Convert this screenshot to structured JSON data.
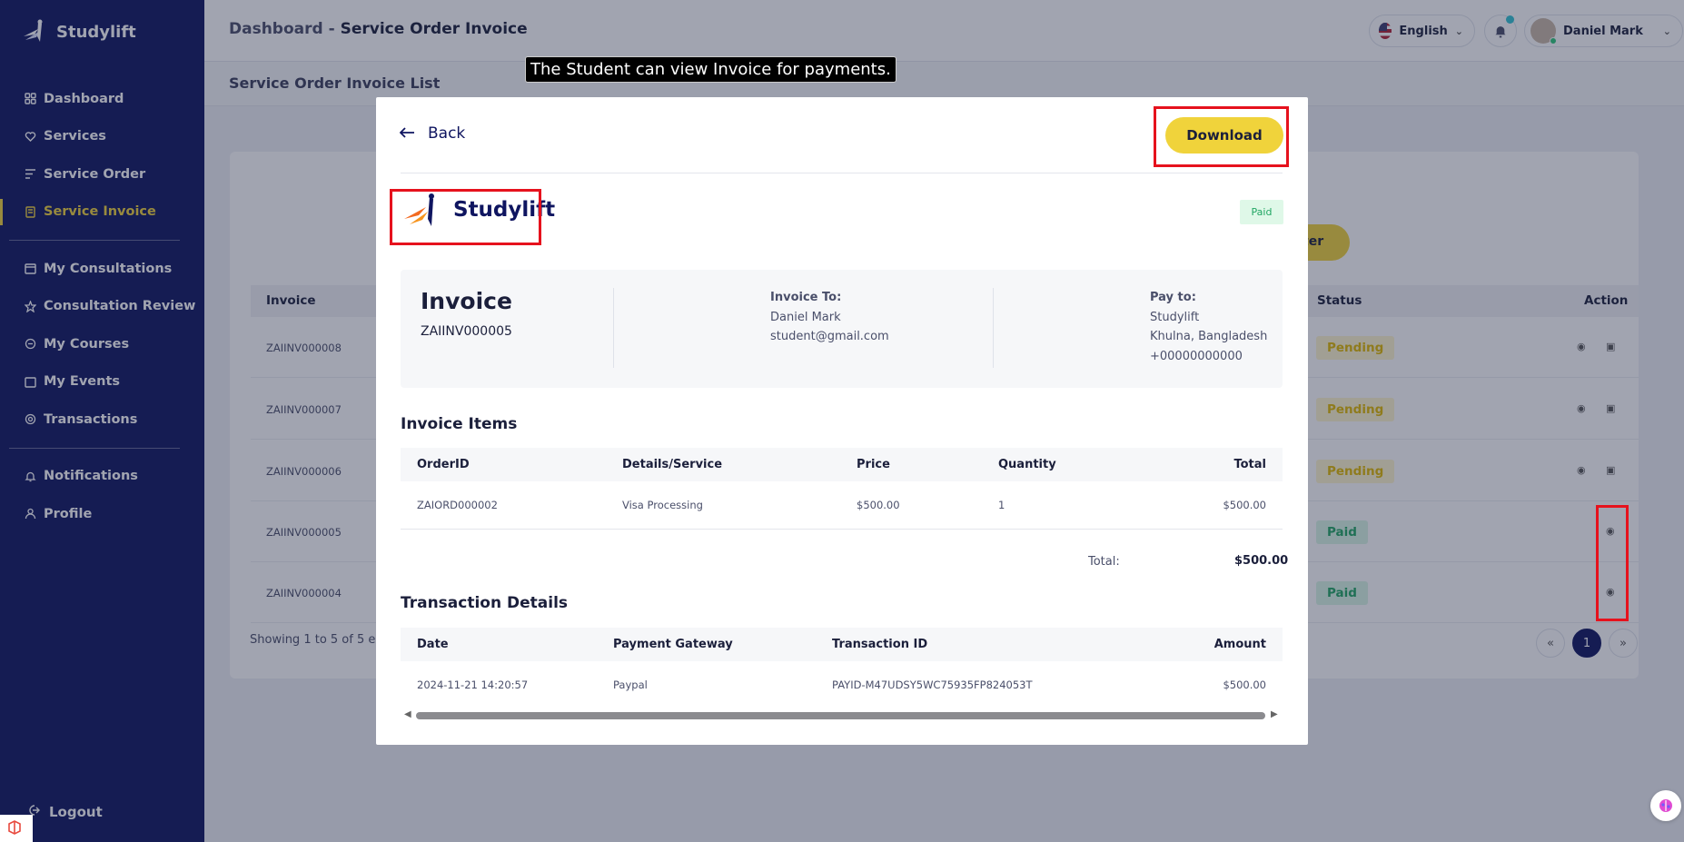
{
  "sidebar": {
    "brand": "Studylift",
    "items": [
      {
        "label": "Dashboard",
        "icon": "grid-icon"
      },
      {
        "label": "Services",
        "icon": "heart-hand-icon"
      },
      {
        "label": "Service Order",
        "icon": "list-filter-icon"
      },
      {
        "label": "Service Invoice",
        "icon": "receipt-icon",
        "active": true
      },
      {
        "label": "My Consultations",
        "icon": "calendar-icon"
      },
      {
        "label": "Consultation Review",
        "icon": "star-icon"
      },
      {
        "label": "My Courses",
        "icon": "graduation-icon"
      },
      {
        "label": "My Events",
        "icon": "event-icon"
      },
      {
        "label": "Transactions",
        "icon": "transfer-icon"
      },
      {
        "label": "Notifications",
        "icon": "bell-icon"
      },
      {
        "label": "Profile",
        "icon": "user-icon"
      }
    ],
    "logout": "Logout"
  },
  "header": {
    "breadcrumb_root": "Dashboard",
    "breadcrumb_sep": "-",
    "breadcrumb_page": "Service Order Invoice",
    "language": "English",
    "user_name": "Daniel Mark"
  },
  "page": {
    "subtitle": "Service Order Invoice List",
    "filter_btn": "ter",
    "columns": {
      "invoice": "Invoice",
      "status": "Status",
      "action": "Action"
    },
    "rows": [
      {
        "invoice": "ZAIINV000008",
        "status": "Pending"
      },
      {
        "invoice": "ZAIINV000007",
        "status": "Pending"
      },
      {
        "invoice": "ZAIINV000006",
        "status": "Pending"
      },
      {
        "invoice": "ZAIINV000005",
        "status": "Paid"
      },
      {
        "invoice": "ZAIINV000004",
        "status": "Paid"
      }
    ],
    "showing": "Showing 1 to 5 of 5 ent",
    "pagination": {
      "prev": "«",
      "current": "1",
      "next": "»"
    }
  },
  "tooltip": "The Student can view Invoice for payments.",
  "modal": {
    "back_label": "Back",
    "download_label": "Download",
    "brand": "Studylift",
    "status_tag": "Paid",
    "invoice_title": "Invoice",
    "invoice_no": "ZAIINV000005",
    "invoice_to": {
      "heading": "Invoice To:",
      "name": "Daniel Mark",
      "email": "student@gmail.com"
    },
    "pay_to": {
      "heading": "Pay to:",
      "name": "Studylift",
      "address": "Khulna, Bangladesh",
      "phone": "+00000000000"
    },
    "items_title": "Invoice Items",
    "items_columns": {
      "order_id": "OrderID",
      "details": "Details/Service",
      "price": "Price",
      "quantity": "Quantity",
      "total": "Total"
    },
    "items": [
      {
        "order_id": "ZAIORD000002",
        "details": "Visa Processing",
        "price": "$500.00",
        "quantity": "1",
        "total": "$500.00"
      }
    ],
    "total_label": "Total:",
    "total_value": "$500.00",
    "tx_title": "Transaction Details",
    "tx_columns": {
      "date": "Date",
      "gateway": "Payment Gateway",
      "tx_id": "Transaction ID",
      "amount": "Amount"
    },
    "transactions": [
      {
        "date": "2024-11-21 14:20:57",
        "gateway": "Paypal",
        "tx_id": "PAYID-M47UDSY5WC75935FP824053T",
        "amount": "$500.00"
      }
    ]
  },
  "colors": {
    "sidebar_bg": "#0f1560",
    "accent_yellow": "#f0d33b",
    "paid_green": "#21a663",
    "pending_yellow": "#e0b800",
    "highlight_red": "#e6121d"
  }
}
